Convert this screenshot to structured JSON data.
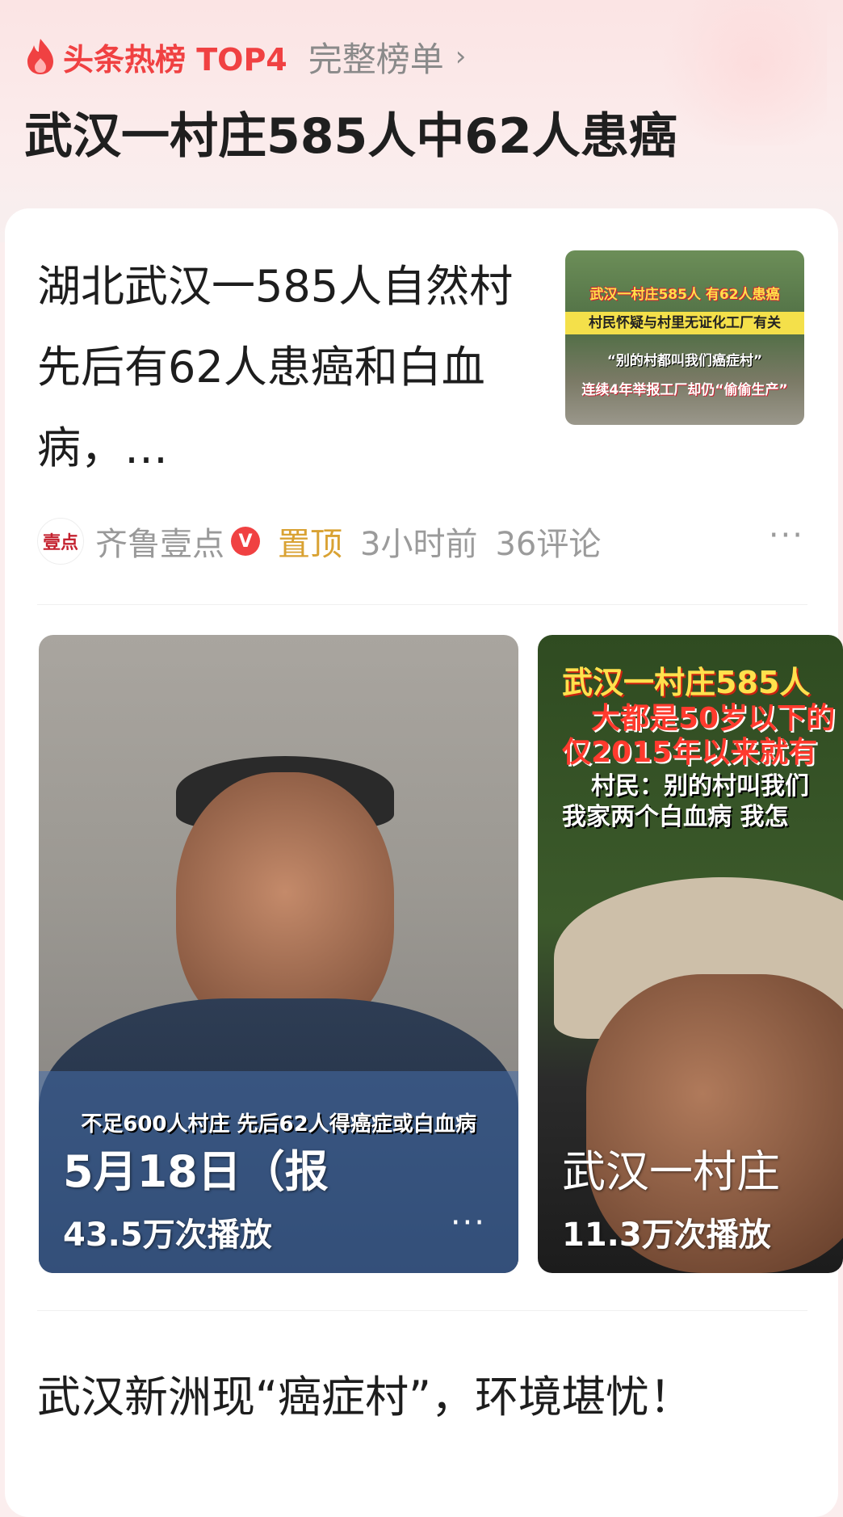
{
  "header": {
    "hot_label": "头条热榜 TOP4",
    "full_list_label": "完整榜单",
    "chevron_icon": "chevron-right-icon",
    "hot_title": "武汉一村庄585人中62人患癌"
  },
  "article": {
    "title": "湖北武汉一585人自然村先后有62人患癌和白血病，…",
    "thumbnail_captions": [
      "武汉一村庄585人 有62人患癌",
      "村民怀疑与村里无证化工厂有关",
      "“别的村都叫我们癌症村”",
      "连续4年举报工厂却仍“偷偷生产”"
    ],
    "source_avatar_text": "壹点",
    "source": "齐鲁壹点",
    "verified_badge": "V",
    "pinned": "置顶",
    "time": "3小时前",
    "comments": "36评论",
    "more": "···"
  },
  "videos": [
    {
      "subtitle": "不足600人村庄 先后62人得癌症或白血病",
      "title": "5月18日（报",
      "play_count": "43.5万次播放",
      "more": "···"
    },
    {
      "captions": [
        "武汉一村庄585人",
        "大都是50岁以下的",
        "仅2015年以来就有",
        "村民：别的村叫我们",
        "我家两个白血病 我怎"
      ],
      "title": "武汉一村庄",
      "play_count": "11.3万次播放"
    }
  ],
  "next_article": {
    "title": "武汉新洲现“癌症村”，环境堪忧！"
  }
}
